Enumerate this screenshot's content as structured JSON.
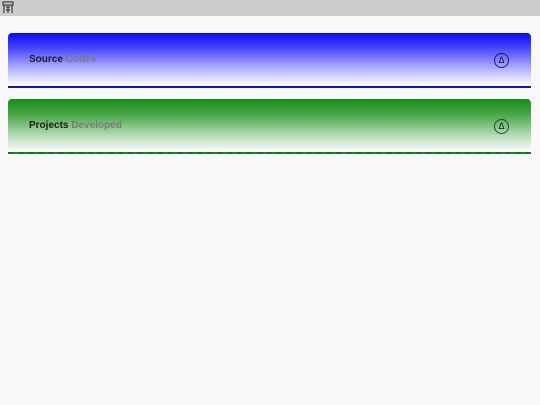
{
  "topbar": {
    "icon": "app-logo-icon"
  },
  "panels": [
    {
      "title_main": "Source",
      "title_rest": "Codes",
      "toggle_glyph": "Δ",
      "accent": "#0a0af5"
    },
    {
      "title_main": "Projects",
      "title_rest": "Developed",
      "toggle_glyph": "Δ",
      "accent": "#1a8a1a"
    }
  ]
}
